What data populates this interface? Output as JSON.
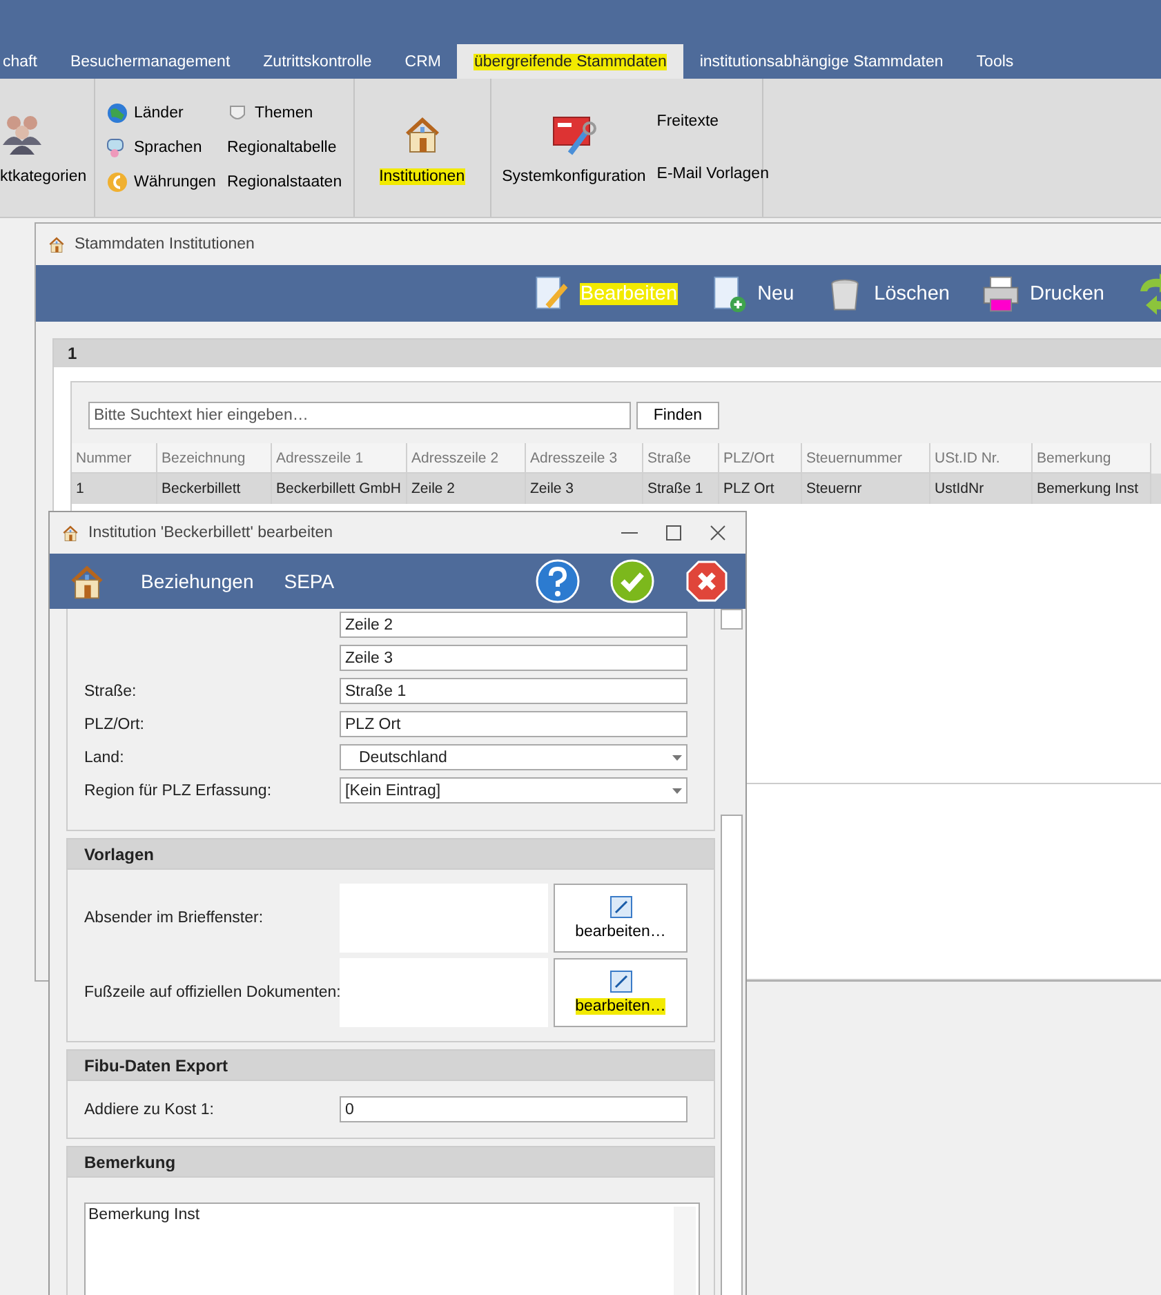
{
  "tabs": [
    {
      "label": "chaft",
      "selected": false,
      "highlighted": false
    },
    {
      "label": "Besuchermanagement",
      "selected": false,
      "highlighted": false
    },
    {
      "label": "Zutrittskontrolle",
      "selected": false,
      "highlighted": false
    },
    {
      "label": "CRM",
      "selected": false,
      "highlighted": false
    },
    {
      "label": "übergreifende Stammdaten",
      "selected": true,
      "highlighted": true
    },
    {
      "label": "institutionsabhängige Stammdaten",
      "selected": false,
      "highlighted": false
    },
    {
      "label": "Tools",
      "selected": false,
      "highlighted": false
    }
  ],
  "ribbon": {
    "groups": [
      {
        "items": [
          {
            "kind": "large",
            "label": "ktkategorien",
            "highlighted": false
          }
        ]
      },
      {
        "items": [
          {
            "kind": "small",
            "label": "Länder",
            "highlighted": false
          },
          {
            "kind": "small",
            "label": "Sprachen",
            "highlighted": false
          },
          {
            "kind": "small",
            "label": "Währungen",
            "highlighted": false
          },
          {
            "kind": "small",
            "label": "Themen",
            "highlighted": false
          },
          {
            "kind": "small",
            "label": "Regionaltabelle",
            "highlighted": false
          },
          {
            "kind": "small",
            "label": "Regionalstaaten",
            "highlighted": false
          }
        ]
      },
      {
        "items": [
          {
            "kind": "large",
            "label": "Institutionen",
            "highlighted": true
          }
        ]
      },
      {
        "items": [
          {
            "kind": "large",
            "label": "Systemkonfiguration",
            "highlighted": false
          },
          {
            "kind": "small",
            "label": "Freitexte",
            "highlighted": false
          },
          {
            "kind": "small",
            "label": "E-Mail Vorlagen",
            "highlighted": false
          }
        ]
      }
    ]
  },
  "main_window": {
    "title": "Stammdaten Institutionen",
    "toolbar": [
      {
        "label": "Bearbeiten",
        "highlighted": true
      },
      {
        "label": "Neu",
        "highlighted": false
      },
      {
        "label": "Löschen",
        "highlighted": false
      },
      {
        "label": "Drucken",
        "highlighted": false
      }
    ],
    "panel_title": "1",
    "search": {
      "placeholder": "Bitte Suchtext hier eingeben…",
      "button": "Finden"
    },
    "table": {
      "columns": [
        "Nummer",
        "Bezeichnung",
        "Adresszeile 1",
        "Adresszeile 2",
        "Adresszeile 3",
        "Straße",
        "PLZ/Ort",
        "Steuernummer",
        "USt.ID Nr.",
        "Bemerkung"
      ],
      "rows": [
        {
          "selected": true,
          "cells": [
            "1",
            "Beckerbillett",
            "Beckerbillett GmbH",
            "Zeile 2",
            "Zeile 3",
            "Straße 1",
            "PLZ Ort",
            "Steuernr",
            "UstIdNr",
            "Bemerkung Inst"
          ]
        }
      ]
    }
  },
  "dialog": {
    "title": "Institution 'Beckerbillett' bearbeiten",
    "tabs": [
      "Beziehungen",
      "SEPA"
    ],
    "sections": [
      {
        "fields": [
          {
            "kind": "text",
            "value": "Zeile 2"
          },
          {
            "kind": "text",
            "value": "Zeile 3"
          },
          {
            "kind": "text",
            "label": "Straße:",
            "value": "Straße 1"
          },
          {
            "kind": "text",
            "label": "PLZ/Ort:",
            "value": "PLZ Ort"
          },
          {
            "kind": "select",
            "label": "Land:",
            "value": "Deutschland"
          },
          {
            "kind": "select",
            "label": "Region für PLZ Erfassung:",
            "value": "[Kein Eintrag]"
          }
        ]
      },
      {
        "title": "Vorlagen",
        "fields": [
          {
            "kind": "template",
            "label": "Absender im Brieffenster:",
            "button": "bearbeiten…",
            "highlighted": false
          },
          {
            "kind": "template",
            "label": "Fußzeile auf offiziellen Dokumenten:",
            "button": "bearbeiten…",
            "highlighted": true
          }
        ]
      },
      {
        "title": "Fibu-Daten Export",
        "fields": [
          {
            "kind": "text",
            "label": "Addiere zu Kost 1:",
            "value": "0"
          }
        ]
      },
      {
        "title": "Bemerkung",
        "fields": [
          {
            "kind": "textarea",
            "value": "Bemerkung Inst"
          }
        ]
      }
    ]
  }
}
